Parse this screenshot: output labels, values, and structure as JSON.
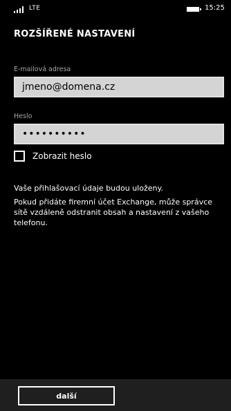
{
  "status": {
    "network": "LTE",
    "time": "15:25",
    "signal_icon": "signal-bars-icon",
    "battery_icon": "battery-icon"
  },
  "page": {
    "title": "ROZŠÍŘENÉ NASTAVENÍ"
  },
  "form": {
    "email_label": "E-mailová adresa",
    "email_value": "jmeno@domena.cz",
    "password_label": "Heslo",
    "password_value": "••••••••••",
    "show_password_label": "Zobrazit heslo",
    "show_password_checked": false
  },
  "info": {
    "line1": "Vaše přihlašovací údaje budou uloženy.",
    "line2": "Pokud přidáte firemní účet Exchange, může správce sítě vzdáleně odstranit obsah a nastavení z vašeho telefonu."
  },
  "app_bar": {
    "next_label": "další"
  },
  "colors": {
    "background": "#000000",
    "input_background": "#d4d4d4",
    "label_gray": "#a8a8a8",
    "app_bar": "#1f1f1f"
  }
}
